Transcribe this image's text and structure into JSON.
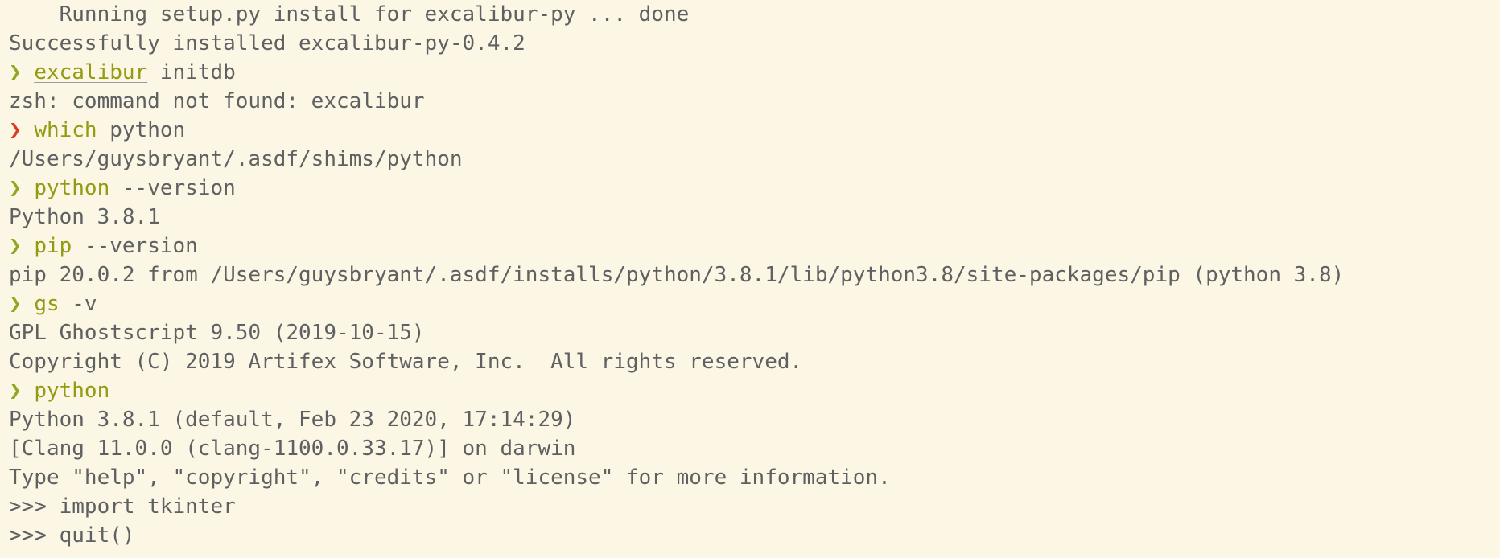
{
  "terminal": {
    "prompt_symbol": "❯",
    "lines": [
      {
        "kind": "output",
        "text": "    Running setup.py install for excalibur-py ... done"
      },
      {
        "kind": "output",
        "text": "Successfully installed excalibur-py-0.4.2"
      },
      {
        "kind": "command",
        "status": "ok",
        "cmd": "excalibur",
        "cmd_unknown": true,
        "args": " initdb"
      },
      {
        "kind": "output",
        "text": "zsh: command not found: excalibur"
      },
      {
        "kind": "command",
        "status": "error",
        "cmd": "which",
        "cmd_unknown": false,
        "args": " python"
      },
      {
        "kind": "output",
        "text": "/Users/guysbryant/.asdf/shims/python"
      },
      {
        "kind": "command",
        "status": "ok",
        "cmd": "python",
        "cmd_unknown": false,
        "args": " --version"
      },
      {
        "kind": "output",
        "text": "Python 3.8.1"
      },
      {
        "kind": "command",
        "status": "ok",
        "cmd": "pip",
        "cmd_unknown": false,
        "args": " --version"
      },
      {
        "kind": "output",
        "text": "pip 20.0.2 from /Users/guysbryant/.asdf/installs/python/3.8.1/lib/python3.8/site-packages/pip (python 3.8)"
      },
      {
        "kind": "command",
        "status": "ok",
        "cmd": "gs",
        "cmd_unknown": false,
        "args": " -v"
      },
      {
        "kind": "output",
        "text": "GPL Ghostscript 9.50 (2019-10-15)"
      },
      {
        "kind": "output",
        "text": "Copyright (C) 2019 Artifex Software, Inc.  All rights reserved."
      },
      {
        "kind": "command",
        "status": "ok",
        "cmd": "python",
        "cmd_unknown": false,
        "args": ""
      },
      {
        "kind": "output",
        "text": "Python 3.8.1 (default, Feb 23 2020, 17:14:29)"
      },
      {
        "kind": "output",
        "text": "[Clang 11.0.0 (clang-1100.0.33.17)] on darwin"
      },
      {
        "kind": "output",
        "text": "Type \"help\", \"copyright\", \"credits\" or \"license\" for more information."
      },
      {
        "kind": "output",
        "text": ">>> import tkinter"
      },
      {
        "kind": "output",
        "text": ">>> quit()"
      }
    ]
  },
  "colors": {
    "background": "#fcf6e4",
    "text": "#5f6062",
    "prompt_ok": "#8fa820",
    "prompt_error": "#dc3b22",
    "command": "#8f9d12"
  }
}
